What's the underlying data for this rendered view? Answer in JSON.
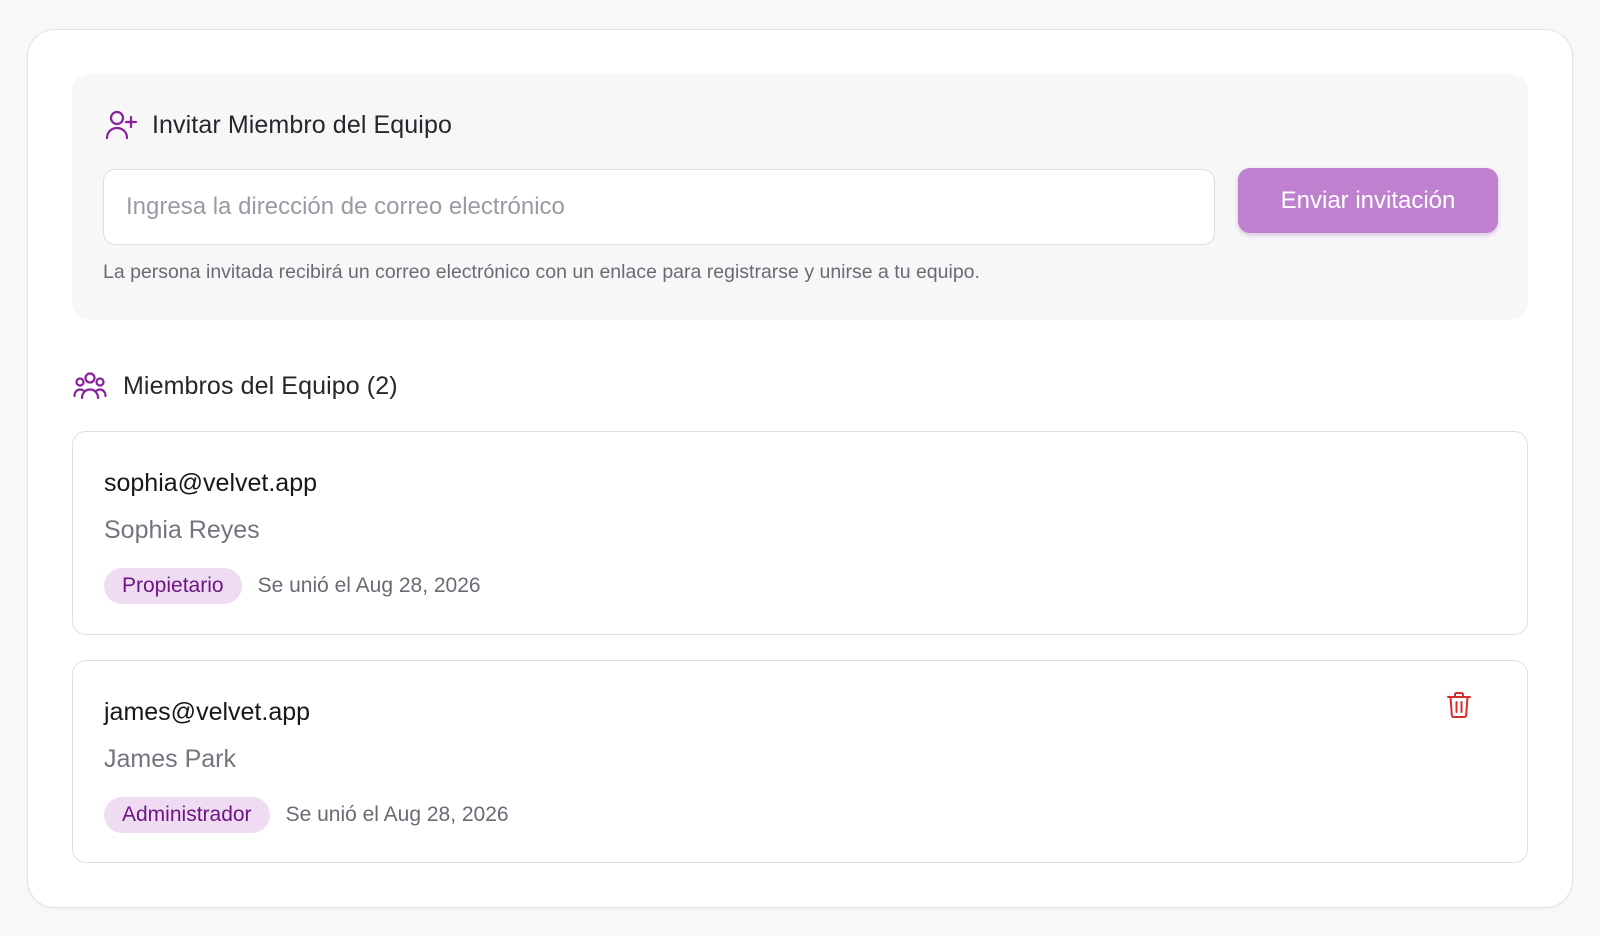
{
  "invite": {
    "title": "Invitar Miembro del Equipo",
    "icon": "user-plus-icon",
    "email_placeholder": "Ingresa la dirección de correo electrónico",
    "email_value": "",
    "send_label": "Enviar invitación",
    "helper": "La persona invitada recibirá un correo electrónico con un enlace para registrarse y unirse a tu equipo."
  },
  "members": {
    "title": "Miembros del Equipo (2)",
    "icon": "users-icon",
    "items": [
      {
        "email": "sophia@velvet.app",
        "name": "Sophia Reyes",
        "role": "Propietario",
        "joined": "Se unió el Aug 28, 2026",
        "deletable": false
      },
      {
        "email": "james@velvet.app",
        "name": "James Park",
        "role": "Administrador",
        "joined": "Se unió el Aug 28, 2026",
        "deletable": true
      }
    ]
  },
  "colors": {
    "accent": "#bf80cf",
    "icon_purple": "#8a1fa0",
    "badge_bg": "#efdcf3",
    "badge_text": "#6d1681",
    "danger": "#d92d2d"
  }
}
